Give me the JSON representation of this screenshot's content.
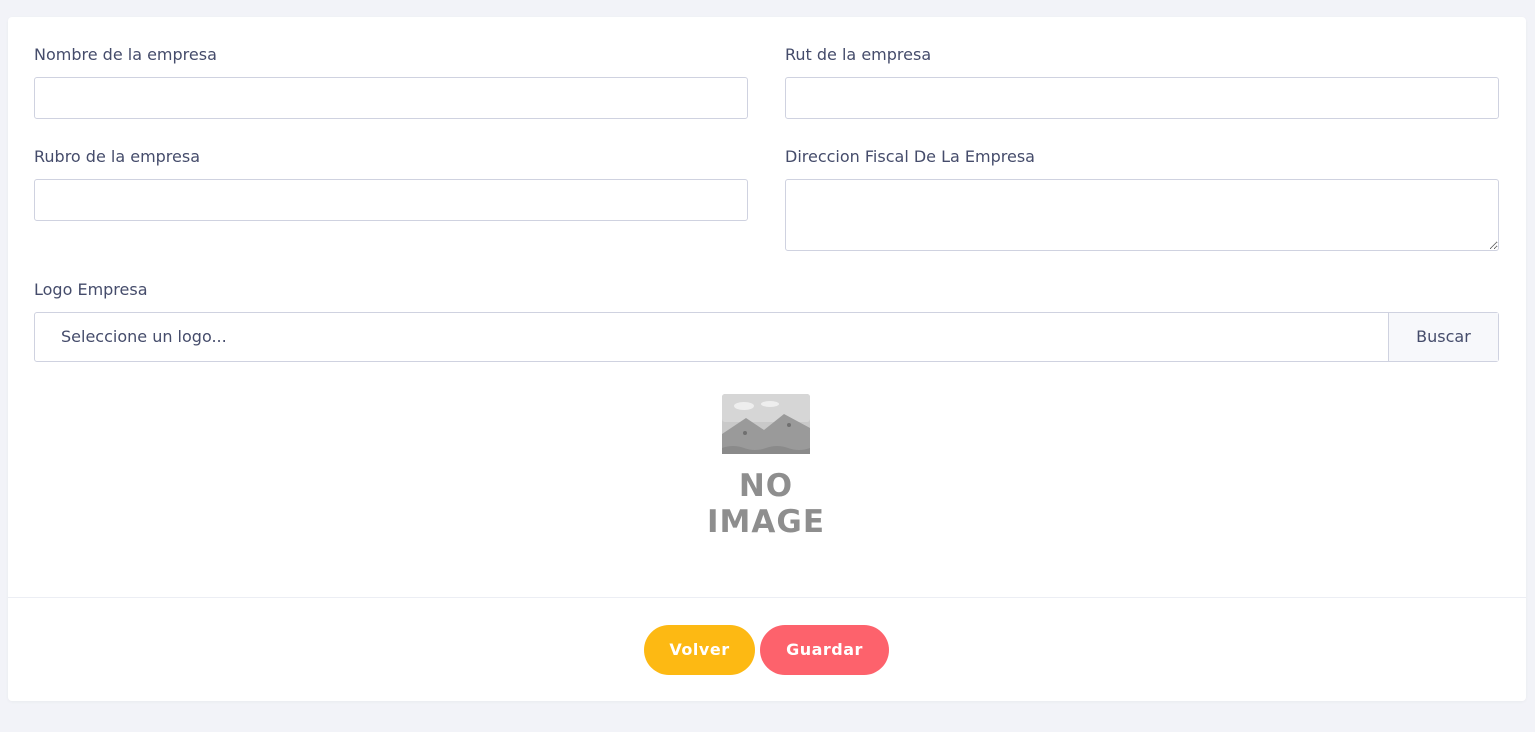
{
  "form": {
    "nombre_label": "Nombre de la empresa",
    "nombre_value": "",
    "rut_label": "Rut de la empresa",
    "rut_value": "",
    "rubro_label": "Rubro de la empresa",
    "rubro_value": "",
    "direccion_label": "Direccion Fiscal De La Empresa",
    "direccion_value": "",
    "logo_label": "Logo Empresa",
    "logo_placeholder": "Seleccione un logo...",
    "logo_browse_label": "Buscar"
  },
  "preview": {
    "icon": "no-image-icon",
    "line1": "NO",
    "line2": "IMAGE"
  },
  "actions": {
    "back_label": "Volver",
    "back_color": "#fdb913",
    "save_label": "Guardar",
    "save_color": "#fd626c"
  }
}
